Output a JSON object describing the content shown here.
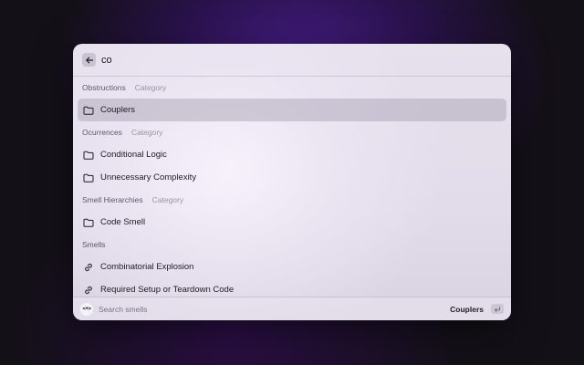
{
  "search": {
    "value": "co"
  },
  "sections": [
    {
      "title": "Obstructions",
      "type": "Category",
      "items": [
        {
          "label": "Couplers",
          "icon": "folder-icon",
          "selected": true
        }
      ]
    },
    {
      "title": "Ocurrences",
      "type": "Category",
      "items": [
        {
          "label": "Conditional Logic",
          "icon": "folder-icon",
          "selected": false
        },
        {
          "label": "Unnecessary Complexity",
          "icon": "folder-icon",
          "selected": false
        }
      ]
    },
    {
      "title": "Smell Hierarchies",
      "type": "Category",
      "items": [
        {
          "label": "Code Smell",
          "icon": "folder-icon",
          "selected": false
        }
      ]
    },
    {
      "title": "Smells",
      "type": "",
      "items": [
        {
          "label": "Combinatorial Explosion",
          "icon": "link-icon",
          "selected": false
        },
        {
          "label": "Required Setup or Teardown Code",
          "icon": "link-icon",
          "selected": false
        }
      ]
    }
  ],
  "footer": {
    "logo_text": "<•>",
    "placeholder": "Search smells",
    "action_label": "Couplers",
    "enter_key_icon": "return-icon"
  },
  "colors": {
    "selected_row": "#a59eaf",
    "accent_glow": "#4a1e8f"
  }
}
